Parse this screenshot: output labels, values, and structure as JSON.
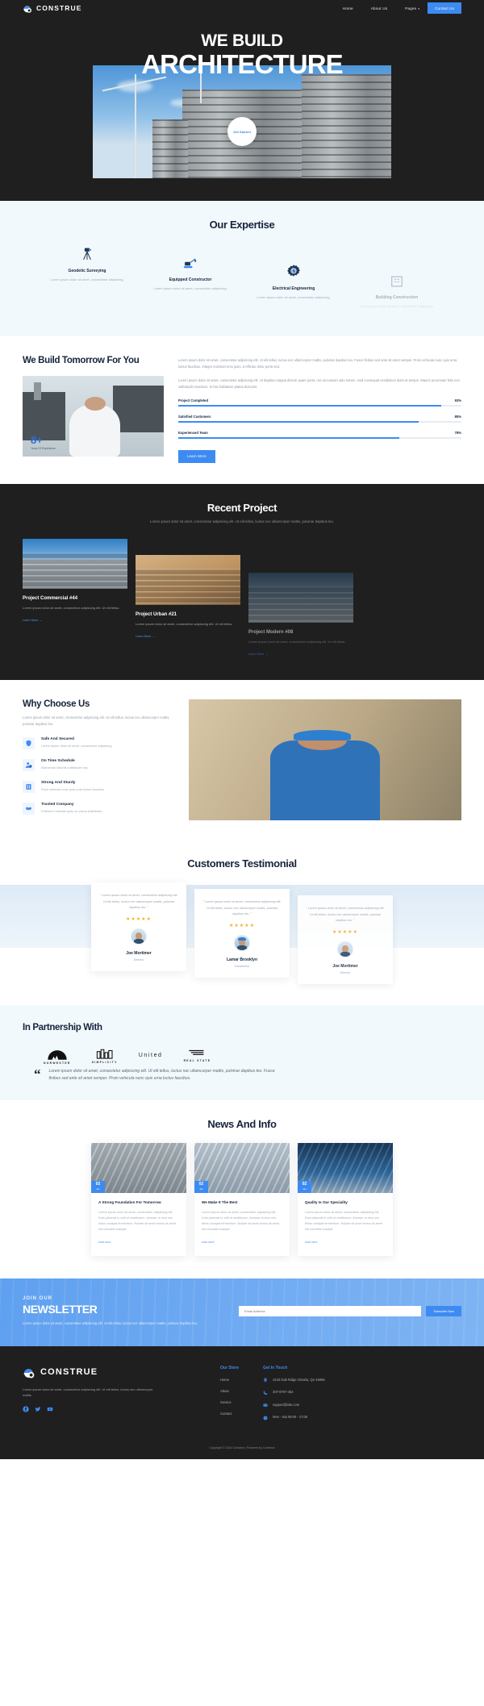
{
  "brand": {
    "name": "CONSTRUE",
    "logo_icon": "helmet-gear-icon"
  },
  "nav": {
    "links": [
      {
        "label": "Home",
        "has_caret": false
      },
      {
        "label": "About Us",
        "has_caret": false
      },
      {
        "label": "Pages",
        "has_caret": true
      }
    ],
    "cta": "Contact Us"
  },
  "hero": {
    "kicker": "WE BUILD",
    "title": "ARCHITECTURE",
    "cta": "Get Started"
  },
  "expertise": {
    "title": "Our Expertise",
    "cards": [
      {
        "icon": "theodolite-icon",
        "name": "Geodetic Surveying",
        "desc": "Lorem ipsum dolor sit amet, consectetur adipiscing."
      },
      {
        "icon": "excavator-icon",
        "name": "Equipped Constructor",
        "desc": "Lorem ipsum dolor sit amet, consectetur adipiscing."
      },
      {
        "icon": "gear-bolt-icon",
        "name": "Electrical Engineering",
        "desc": "Lorem ipsum dolor sit amet, consectetur adipiscing."
      },
      {
        "icon": "building-icon",
        "name": "Building Construction",
        "desc": "Lorem ipsum dolor sit amet, consectetur adipiscing."
      }
    ]
  },
  "about": {
    "heading": "We Build Tomorrow For You",
    "badge_number": "8+",
    "badge_text": "Years Of Experience",
    "paragraphs": [
      "Lorem ipsum dolor sit amet, consectetur adipiscing elit. Ut elit tellus, luctus nec ullamcorper mattis, pulvinar dapibus leo. Fusce finibus sed ante sit amet semper. Proin vehicula nunc quis urna luctus faucibus. Integer euismod eros justo, a efficitur dolor porta sed.",
      "Lorem ipsum dolor sit amet, consectetur adipiscing elit. Ut dapibus magna dictum quam porta, nec accumsan odio rutrum. Sed consequat vestibulum diam at tempor. Mauris accumsan felis non sollicitudin maximus. In hac habitasse platea dictumst.",
      "Lorem ipsum dolor sit amet, consectetur adipiscing elit."
    ],
    "bars": [
      {
        "label": "Project Completed",
        "value": "93%",
        "pct": 93
      },
      {
        "label": "Satisfied Customers",
        "value": "85%",
        "pct": 85
      },
      {
        "label": "Experienced Team",
        "value": "78%",
        "pct": 78
      }
    ],
    "cta": "Learn More"
  },
  "projects": {
    "title": "Recent Project",
    "subtitle": "Lorem ipsum dolor sit amet, consectetur adipiscing elit. Ut elit tellus, luctus nec ullamcorper mattis, pulvinar dapibus leo.",
    "items": [
      {
        "title": "Project Commercial #44",
        "desc": "Lorem ipsum dolor sit amet, consectetur adipiscing elit. Ut elit tellus.",
        "link": "Learn More →"
      },
      {
        "title": "Project Urban #21",
        "desc": "Lorem ipsum dolor sit amet, consectetur adipiscing elit. Ut elit tellus.",
        "link": "Learn More →"
      },
      {
        "title": "Project Modern #08",
        "desc": "Lorem ipsum dolor sit amet, consectetur adipiscing elit. Ut elit tellus.",
        "link": "Learn More →"
      }
    ]
  },
  "why": {
    "heading": "Why Choose Us",
    "paragraph": "Lorem ipsum dolor sit amet, consectetur adipiscing elit. Ut elit tellus, luctus nec ullamcorper mattis, pulvinar dapibus leo.",
    "features": [
      {
        "icon": "shield-icon",
        "title": "Safe And Secured",
        "desc": "Lorem ipsum dolor sit amet, consectetur adipiscing."
      },
      {
        "icon": "user-clock-icon",
        "title": "On Time Schedule",
        "desc": "Maecenas lobortis sollicitudin nisi."
      },
      {
        "icon": "pillar-icon",
        "title": "Strong And Sturdy",
        "desc": "Proin vehicula nunc quis urna luctus faucibus."
      },
      {
        "icon": "handshake-icon",
        "title": "Trusted Company",
        "desc": "Praesent molestie justo ac purus sollicitudin."
      }
    ]
  },
  "testimonials": {
    "title": "Customers Testimonial",
    "items": [
      {
        "quote": "\" Lorem ipsum dolor sit amet, consectetur adipiscing elit. Ut elit tellus, luctus nec ullamcorper mattis, pulvinar dapibus leo. \"",
        "stars": "★★★★★",
        "name": "Joe Mortimer",
        "role": "Director"
      },
      {
        "quote": "\" Lorem ipsum dolor sit amet, consectetur adipiscing elit. Ut elit tellus, luctus nec ullamcorper mattis, pulvinar dapibus leo. \"",
        "stars": "★★★★★",
        "name": "Lamar Brooklyn",
        "role": "Constructor"
      },
      {
        "quote": "\" Lorem ipsum dolor sit amet, consectetur adipiscing elit. Ut elit tellus, luctus nec ullamcorper mattis, pulvinar dapibus leo. \"",
        "stars": "★★★★★",
        "name": "Joe Mortimer",
        "role": "Director"
      }
    ]
  },
  "partners": {
    "title": "In Partnership With",
    "logos": [
      {
        "name": "NORWESTER",
        "icon": "mountain-icon"
      },
      {
        "name": "SIMPLICITY",
        "icon": "city-skyline-icon"
      },
      {
        "name": "United",
        "icon": "text-logo"
      },
      {
        "name": "REAL STATE",
        "icon": "flag-lines-icon"
      }
    ],
    "quote_mark": "“",
    "quote": "Lorem ipsum dolor sit amet, consectetur adipiscing elit. Ut elit tellus, luctus nec ullamcorper mattis, pulvinar dapibus leo. Fusce finibus sed ante sit amet semper. Proin vehicula nunc quis urna luctus faucibus."
  },
  "news": {
    "title": "News And Info",
    "items": [
      {
        "day": "02",
        "month": "Jan",
        "title": "A Strong Foundation For Tomorrow",
        "desc": "Lorem ipsum dolor sit amet, consectetur adipiscing elit. Duis placerat in velit ut vestibulum. Aenean ut arcu nec tellus volutpat fermentum. Nullam sit amet lectus sit amet est convallis suscipit.",
        "link": "read more"
      },
      {
        "day": "02",
        "month": "Jan",
        "title": "We Make It The Best",
        "desc": "Lorem ipsum dolor sit amet, consectetur adipiscing elit. Duis placerat in velit ut vestibulum. Aenean ut arcu nec tellus volutpat fermentum. Nullam sit amet lectus sit amet est convallis suscipit.",
        "link": "read more"
      },
      {
        "day": "02",
        "month": "Jan",
        "title": "Quality Is Our Speciality",
        "desc": "Lorem ipsum dolor sit amet, consectetur adipiscing elit. Duis placerat in velit ut vestibulum. Aenean ut arcu nec tellus volutpat fermentum. Nullam sit amet lectus sit amet est convallis suscipit.",
        "link": "read more"
      }
    ]
  },
  "newsletter": {
    "kicker": "JOIN OUR",
    "title": "NEWSLETTER",
    "paragraph": "Lorem ipsum dolor sit amet, consectetur adipiscing elit. Ut elit tellus, luctus nec ullamcorper mattis, pulvinar dapibus leo.",
    "placeholder": "Email Address",
    "button": "Subscribe Now"
  },
  "footer": {
    "brand": "CONSTRUE",
    "about": "Lorem ipsum dolor sit amet, consectetur adipiscing elit. Ut elit tellus, luctus nec ullamcorper mattis.",
    "social": [
      "facebook-icon",
      "twitter-icon",
      "youtube-icon"
    ],
    "store": {
      "heading": "Our Store",
      "links": [
        "Home",
        "About",
        "Service",
        "Contact"
      ]
    },
    "touch": {
      "heading": "Get In Touch",
      "items": [
        {
          "icon": "location-pin-icon",
          "text": "2443 Oak Ridge Omaha, QA 45065"
        },
        {
          "icon": "phone-icon",
          "text": "207-8767-452"
        },
        {
          "icon": "mail-icon",
          "text": "support@site.com"
        },
        {
          "icon": "clock-icon",
          "text": "Mon - Sat 09:00 - 17:00"
        }
      ]
    },
    "copyright": "Copyright © 2024 Construe | Powered by Construe"
  },
  "colors": {
    "accent": "#3d8bf2",
    "dark": "#1f1f1f",
    "ink": "#16243a",
    "light": "#f2f9fd"
  }
}
